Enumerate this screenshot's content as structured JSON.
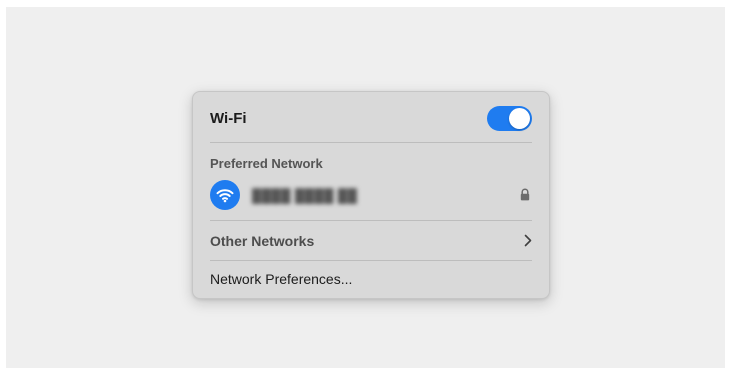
{
  "wifi_panel": {
    "title": "Wi-Fi",
    "toggle_state": "on",
    "accent_color": "#1f7cf0"
  },
  "preferred": {
    "section_label": "Preferred Network",
    "network_name": "████ ████ ██",
    "network_icon": "wifi-icon",
    "secured_icon": "lock-icon"
  },
  "other_networks": {
    "label": "Other Networks",
    "icon": "chevron-right-icon"
  },
  "preferences": {
    "label": "Network Preferences..."
  }
}
